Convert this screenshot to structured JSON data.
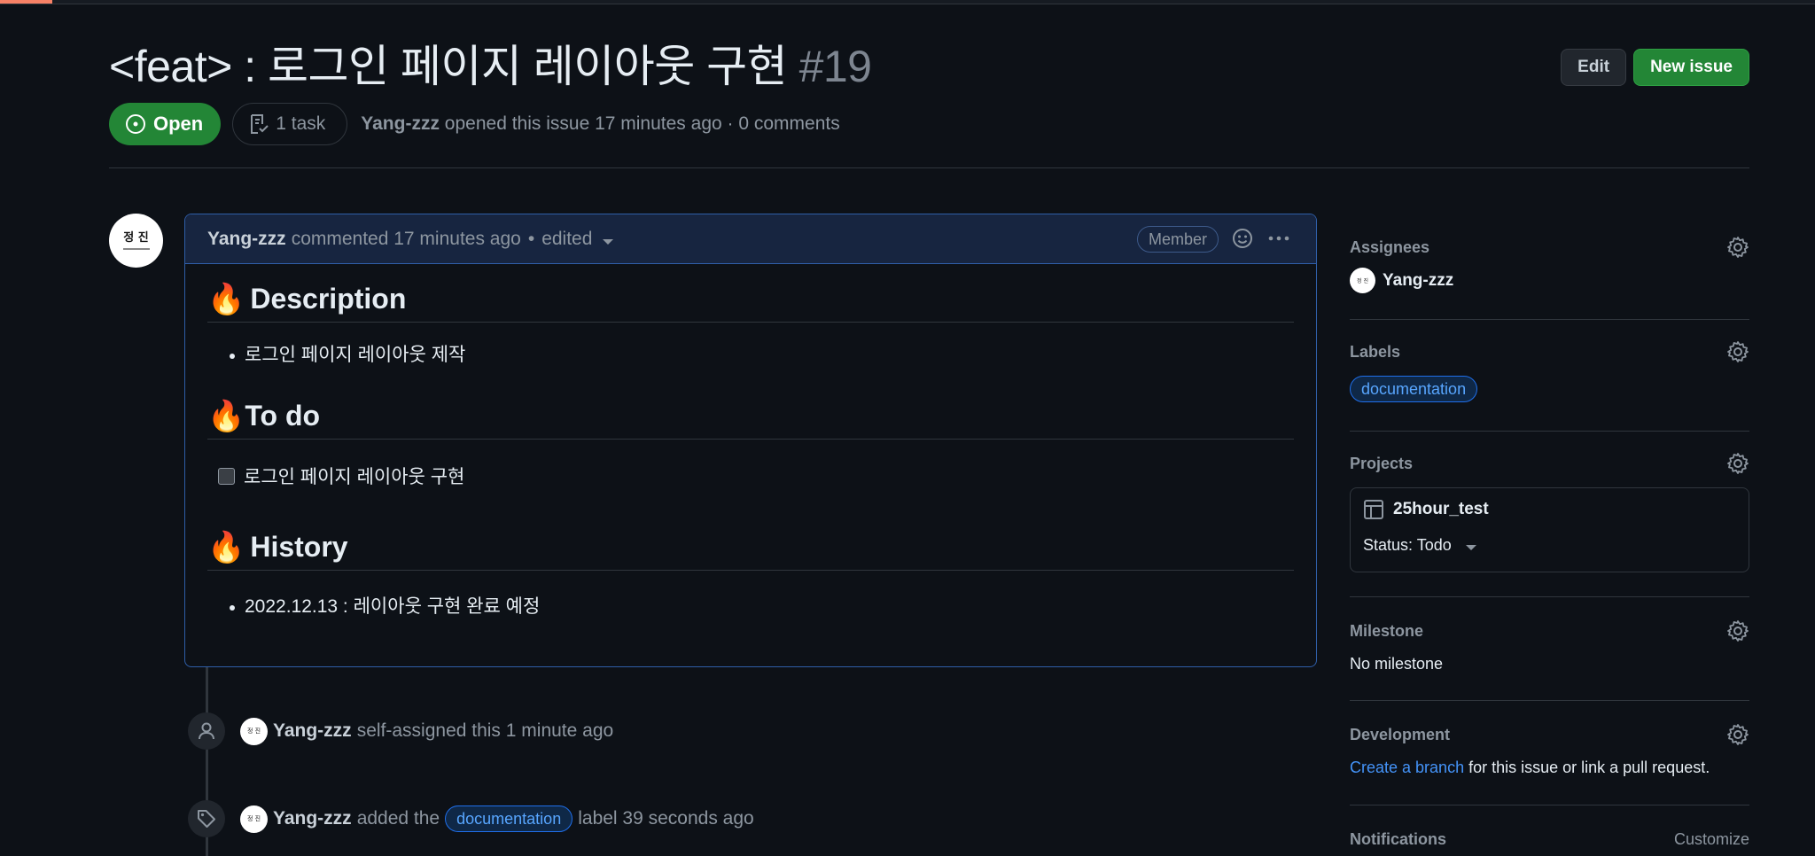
{
  "issue": {
    "title": "<feat> : 로그인 페이지 레이아웃 구현",
    "number": "#19",
    "state": "Open",
    "tasks": "1 task",
    "author": "Yang-zzz",
    "opened_text": "opened this issue 17 minutes ago · 0 comments",
    "progress_fraction": 0.029
  },
  "header_actions": {
    "edit_label": "Edit",
    "new_issue_label": "New issue"
  },
  "avatar": {
    "text": "정 진"
  },
  "comment": {
    "author": "Yang-zzz",
    "action": "commented 17 minutes ago",
    "edited": "edited",
    "role_badge": "Member",
    "sections": [
      {
        "heading": "Description",
        "items": [
          "로그인 페이지 레이아웃 제작"
        ]
      },
      {
        "heading": "To do",
        "tasks": [
          "로그인 페이지 레이아웃 구현"
        ]
      },
      {
        "heading": "History",
        "items": [
          "2022.12.13 : 레이아웃 구현 완료 예정"
        ]
      }
    ]
  },
  "timeline": [
    {
      "icon": "person-icon",
      "author": "Yang-zzz",
      "text": "self-assigned this 1 minute ago"
    },
    {
      "icon": "tag-icon",
      "author": "Yang-zzz",
      "text_before": "added the",
      "label": "documentation",
      "text_after": "label 39 seconds ago"
    }
  ],
  "sidebar": {
    "assignees": {
      "title": "Assignees",
      "user": "Yang-zzz"
    },
    "labels": {
      "title": "Labels",
      "items": [
        "documentation"
      ]
    },
    "projects": {
      "title": "Projects",
      "name": "25hour_test",
      "status": "Status: Todo"
    },
    "milestone": {
      "title": "Milestone",
      "value": "No milestone"
    },
    "development": {
      "title": "Development",
      "link": "Create a branch",
      "rest": "for this issue or link a pull request."
    },
    "notifications": {
      "title": "Notifications",
      "customize": "Customize"
    }
  },
  "colors": {
    "background": "#0d1117",
    "open_green": "#238636",
    "link_blue": "#4493f8",
    "comment_border": "#2f5ea8"
  }
}
